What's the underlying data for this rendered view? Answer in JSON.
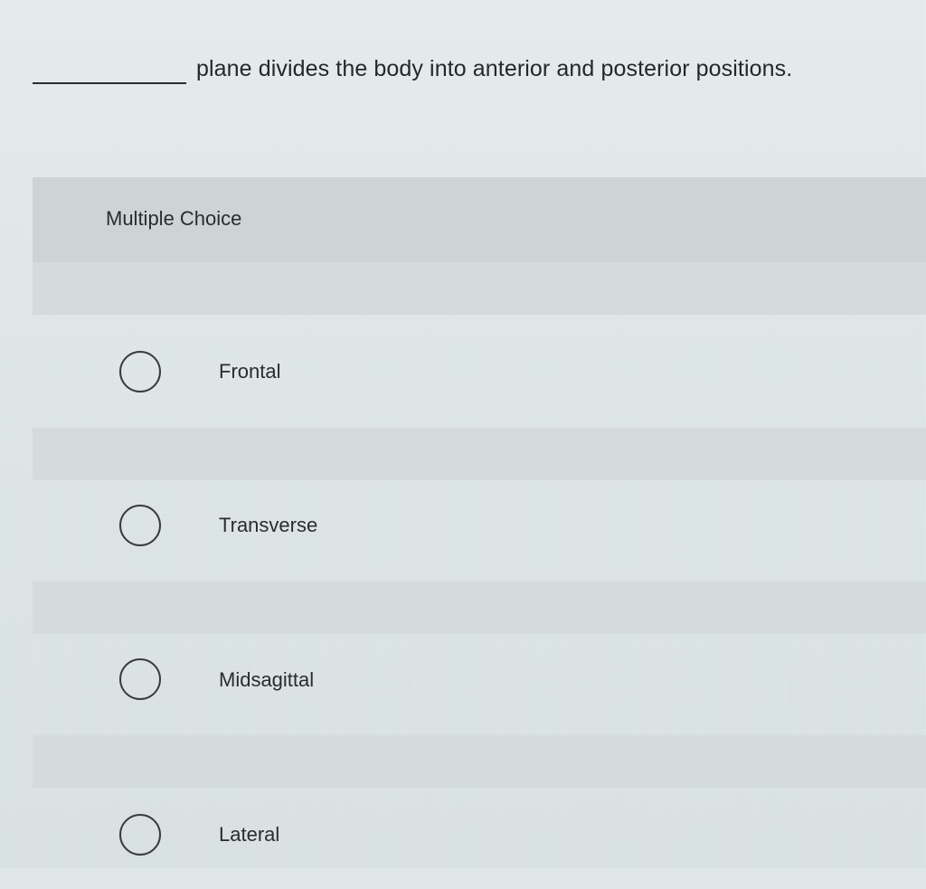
{
  "question": {
    "text": "plane divides the body into anterior and posterior positions."
  },
  "multiple_choice": {
    "label": "Multiple Choice",
    "options": [
      {
        "label": "Frontal",
        "selected": false
      },
      {
        "label": "Transverse",
        "selected": false
      },
      {
        "label": "Midsagittal",
        "selected": false
      },
      {
        "label": "Lateral",
        "selected": false
      }
    ]
  }
}
